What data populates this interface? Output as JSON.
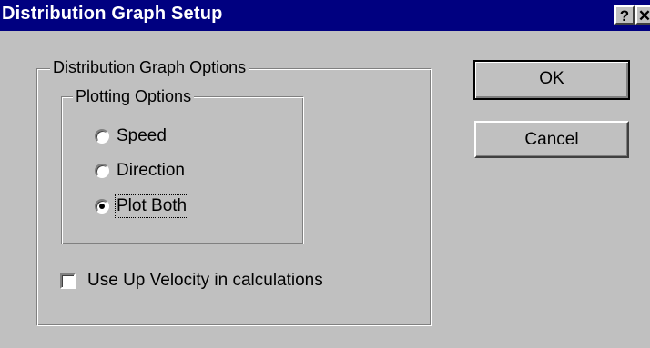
{
  "window": {
    "title": "Distribution Graph Setup",
    "help_glyph": "?",
    "close_glyph": "✕"
  },
  "options_group": {
    "label": "Distribution Graph Options"
  },
  "plotting_group": {
    "label": "Plotting Options",
    "radios": [
      {
        "label": "Speed",
        "checked": false
      },
      {
        "label": "Direction",
        "checked": false
      },
      {
        "label": "Plot Both",
        "checked": true
      }
    ]
  },
  "checkbox": {
    "label": "Use Up Velocity in calculations",
    "checked": false
  },
  "buttons": {
    "ok_label": "OK",
    "cancel_label": "Cancel"
  },
  "colors": {
    "titlebar": "#000080",
    "face": "#c0c0c0"
  }
}
